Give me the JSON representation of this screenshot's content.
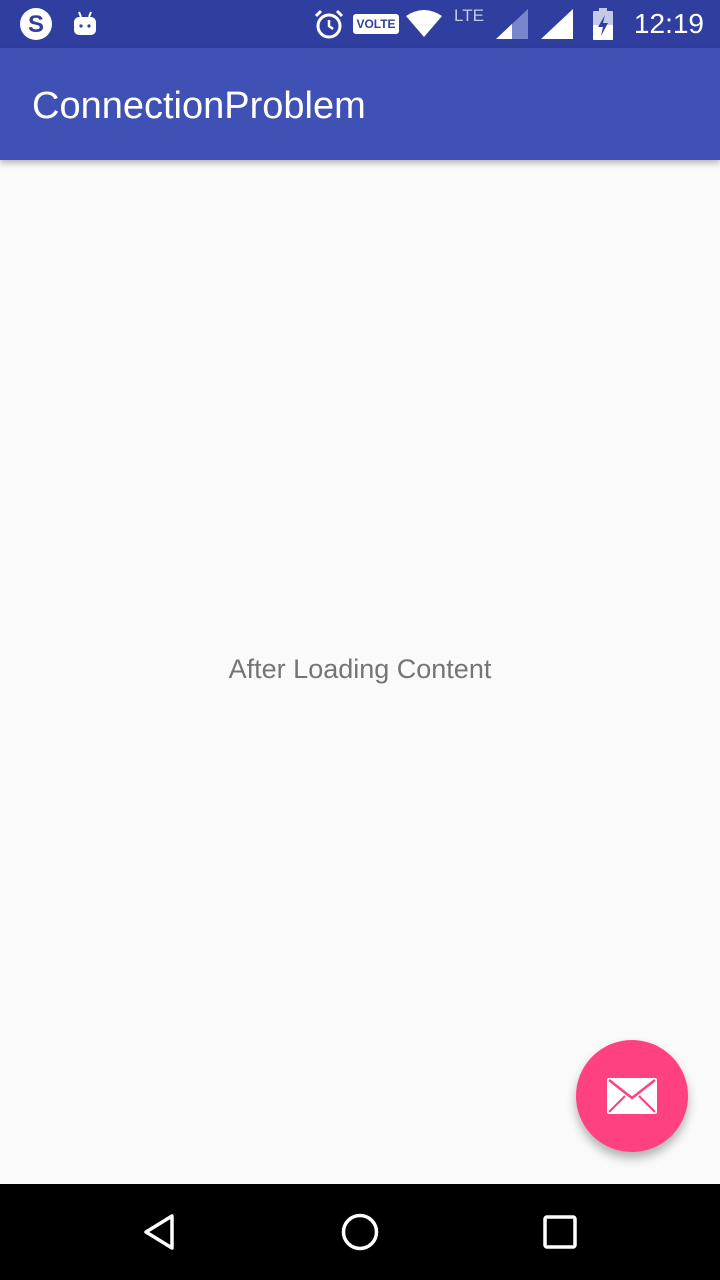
{
  "status_bar": {
    "time": "12:19",
    "volte_label": "VOLTE",
    "lte_label": "LTE",
    "icons": [
      "skype-icon",
      "android-icon",
      "alarm-icon",
      "volte-icon",
      "wifi-icon",
      "lte-signal-icon",
      "signal-icon",
      "battery-charging-icon"
    ]
  },
  "app_bar": {
    "title": "ConnectionProblem"
  },
  "main": {
    "message": "After Loading Content"
  },
  "fab": {
    "icon": "mail-icon"
  },
  "nav_bar": {
    "icons": [
      "back-icon",
      "home-icon",
      "recents-icon"
    ]
  },
  "colors": {
    "status_bar": "#303f9f",
    "app_bar": "#3f51b5",
    "accent": "#ff4081",
    "background": "#fafafa"
  }
}
